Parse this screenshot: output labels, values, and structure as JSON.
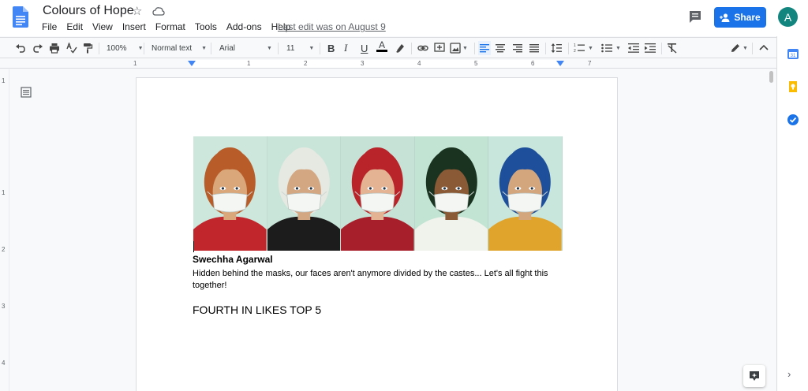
{
  "document": {
    "title": "Colours of Hope",
    "last_edit": "Last edit was on August 9"
  },
  "menu": [
    "File",
    "Edit",
    "View",
    "Insert",
    "Format",
    "Tools",
    "Add-ons",
    "Help"
  ],
  "share": {
    "label": "Share"
  },
  "account": {
    "initial": "A"
  },
  "toolbar": {
    "zoom": "100%",
    "style": "Normal text",
    "font": "Arial",
    "font_size": "11"
  },
  "ruler": {
    "numbers": [
      "1",
      "1",
      "2",
      "3",
      "4",
      "5",
      "6",
      "7"
    ],
    "vertical_numbers": [
      "1",
      "1",
      "2",
      "3",
      "4"
    ]
  },
  "content": {
    "author": "Swechha Agarwal",
    "description": "Hidden behind the masks, our faces aren't anymore divided by the castes... Let's all fight this together!",
    "heading": "FOURTH IN LIKES TOP 5"
  },
  "artwork": {
    "panels": [
      {
        "bg": "#cde7dc",
        "hair": "#b85c2a",
        "skin": "#d9a77a",
        "clothing": "#c0262c"
      },
      {
        "bg": "#c9e5d9",
        "hair": "#e6e9e2",
        "skin": "#d4a783",
        "clothing": "#1c1c1c"
      },
      {
        "bg": "#c6e2d6",
        "hair": "#b8242a",
        "skin": "#e3b393",
        "clothing": "#a81f2c"
      },
      {
        "bg": "#c1e4d3",
        "hair": "#1a3320",
        "skin": "#8a5a36",
        "clothing": "#f0f2ec"
      },
      {
        "bg": "#c9e6dc",
        "hair": "#1d4f9a",
        "skin": "#d4a67e",
        "clothing": "#e0a42c"
      }
    ]
  },
  "colors": {
    "accent": "#1a73e8",
    "avatar": "#12857f"
  }
}
